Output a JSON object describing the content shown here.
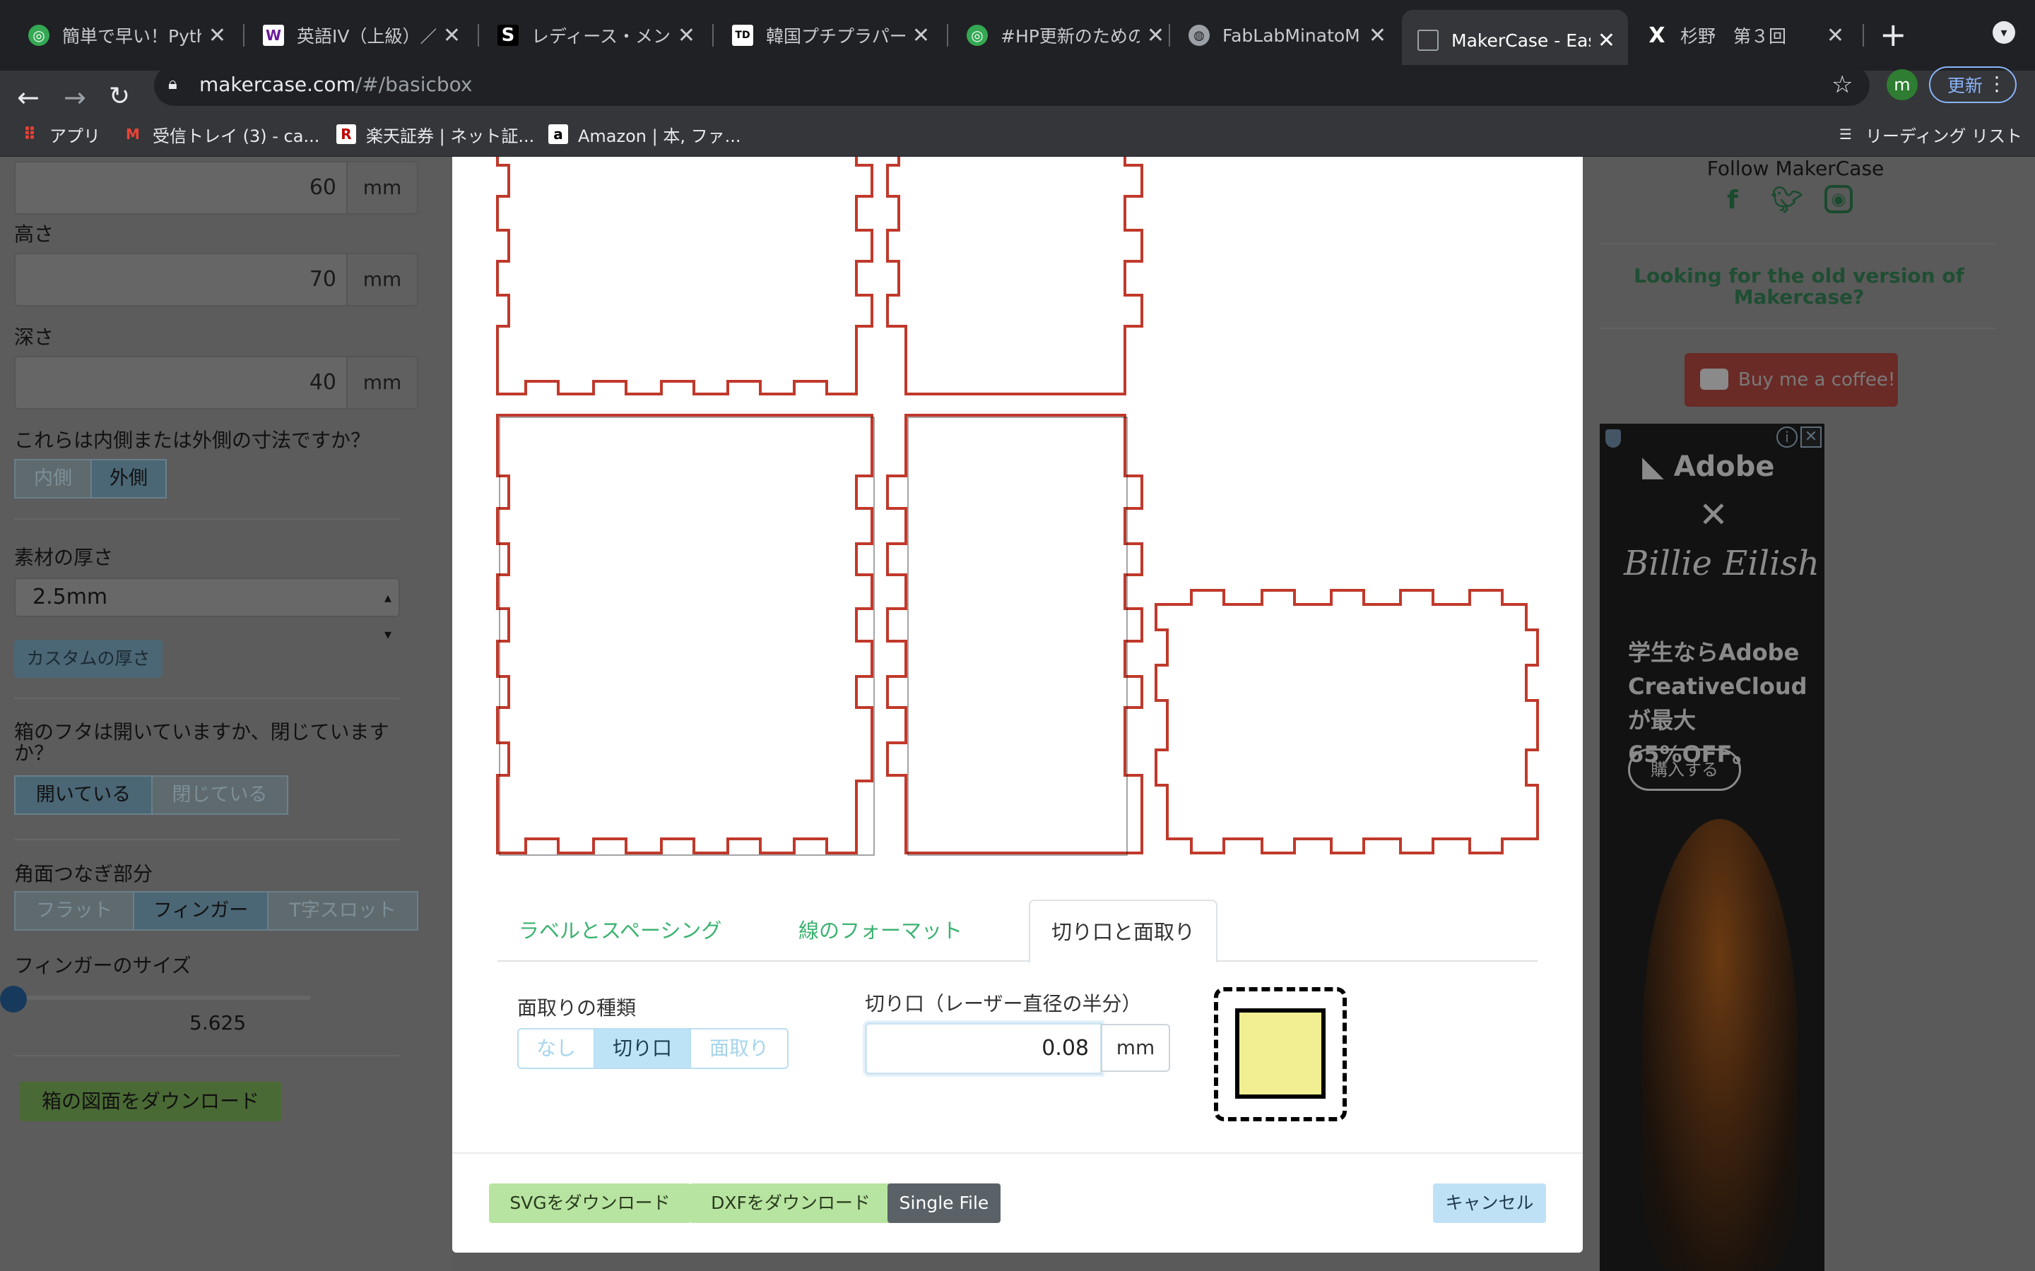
{
  "browser": {
    "tabs": [
      {
        "title": "簡単で早い！Pytho",
        "icon": "green-circle-icon",
        "color": "#34a853"
      },
      {
        "title": "英語IV（上級）／上",
        "icon": "w-doc-icon",
        "color": "#ffffff"
      },
      {
        "title": "レディース・メンズ",
        "icon": "s-logo-icon",
        "color": "#000000"
      },
      {
        "title": "韓国プチプラパーテ",
        "icon": "td-logo-icon",
        "color": "#ffffff"
      },
      {
        "title": "#HP更新のためのコ",
        "icon": "green-circle-icon",
        "color": "#34a853"
      },
      {
        "title": "FabLabMinatoMir",
        "icon": "globe-icon",
        "color": "#9aa0a6"
      },
      {
        "title": "MakerCase - Easy",
        "icon": "makercase-icon",
        "color": "#9aa0a6"
      },
      {
        "title": "杉野　第３回",
        "icon": "x-logo-icon",
        "color": "#ffffff"
      }
    ],
    "active_tab_index": 6,
    "url_host": "makercase.com",
    "url_path": "/#/basicbox",
    "profile_initial": "m",
    "update_label": "更新",
    "bookmarks": [
      {
        "label": "アプリ",
        "icon": "apps-grid-icon"
      },
      {
        "label": "受信トレイ (3) - ca...",
        "icon": "gmail-icon"
      },
      {
        "label": "楽天証券 | ネット証...",
        "icon": "rakuten-icon"
      },
      {
        "label": "Amazon | 本, ファ...",
        "icon": "amazon-icon"
      }
    ],
    "reading_list": "リーディング リスト"
  },
  "left_panel": {
    "width_value": "60",
    "height_label": "高さ",
    "height_value": "70",
    "depth_label": "深さ",
    "depth_value": "40",
    "unit": "mm",
    "dimension_question": "これらは内側または外側の寸法ですか？",
    "dimension_options": [
      "内側",
      "外側"
    ],
    "dimension_selected": "外側",
    "thickness_label": "素材の厚さ",
    "thickness_value": "2.5mm",
    "custom_thickness": "カスタムの厚さ",
    "lid_question": "箱のフタは開いていますか、閉じていますか？",
    "lid_options": [
      "開いている",
      "閉じている"
    ],
    "lid_selected": "開いている",
    "edge_label": "角面つなぎ部分",
    "edge_options": [
      "フラット",
      "フィンガー",
      "T字スロット"
    ],
    "edge_selected": "フィンガー",
    "finger_size_label": "フィンガーのサイズ",
    "finger_size_value": "5.625",
    "finger_slider_fraction": 0,
    "download_box": "箱の図面をダウンロード"
  },
  "right_panel": {
    "follow": "Follow MakerCase",
    "social": [
      "facebook-icon",
      "twitter-icon",
      "instagram-icon"
    ],
    "old_version": "Looking for the old version of Makercase?",
    "coffee": "Buy me a coffee!",
    "ad": {
      "brand": "Adobe",
      "artist": "Billie Eilish",
      "headline": "学生ならAdobe CreativeCloudが最大65%OFF。",
      "cta": "購入する"
    }
  },
  "modal": {
    "tabs": [
      "ラベルとスペーシング",
      "線のフォーマット",
      "切り口と面取り"
    ],
    "active_tab": "切り口と面取り",
    "kerf_type_label": "面取りの種類",
    "kerf_type_options": [
      "なし",
      "切り口",
      "面取り"
    ],
    "kerf_type_selected": "切り口",
    "kerf_label": "切り口（レーザー直径の半分）",
    "kerf_value": "0.08",
    "kerf_unit": "mm",
    "swatch_color": "#f2ee92",
    "outline_color": "#c0392b",
    "buttons": {
      "svg": "SVGをダウンロード",
      "dxf": "DXFをダウンロード",
      "single": "Single File",
      "cancel": "キャンセル"
    }
  }
}
